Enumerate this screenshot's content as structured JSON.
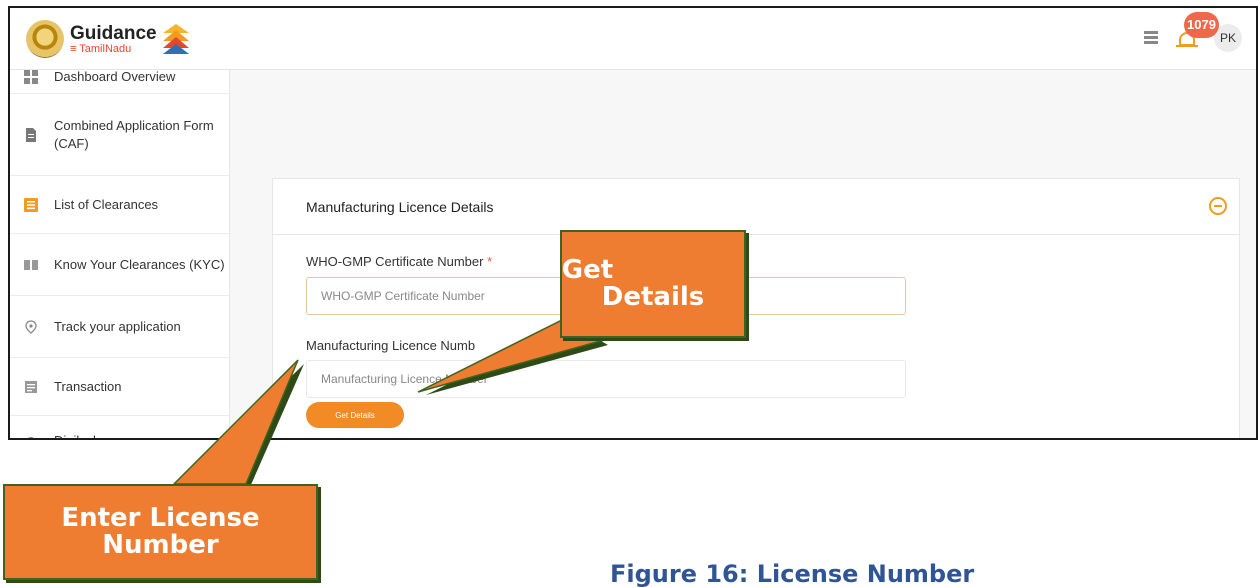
{
  "header": {
    "brand_name": "Guidance",
    "brand_sub": "TamilNadu",
    "notification_count": "1079",
    "avatar_initials": "PK"
  },
  "sidebar": {
    "items": [
      {
        "label": "Dashboard Overview",
        "icon": "dashboard-icon"
      },
      {
        "label": "Combined Application Form (CAF)",
        "icon": "document-icon"
      },
      {
        "label": "List of Clearances",
        "icon": "list-icon",
        "active_color": "#f29b22"
      },
      {
        "label": "Know Your Clearances (KYC)",
        "icon": "book-icon"
      },
      {
        "label": "Track your application",
        "icon": "location-pin-icon"
      },
      {
        "label": "Transaction",
        "icon": "receipt-icon"
      },
      {
        "label": "Digilocker",
        "icon": "cloud-icon"
      }
    ]
  },
  "card": {
    "title": "Manufacturing Licence Details",
    "who_gmp_label": "WHO-GMP Certificate Number",
    "who_gmp_placeholder": "WHO-GMP Certificate Number",
    "required_mark": "*",
    "licence_label": "Manufacturing Licence Numb",
    "licence_placeholder": "Manufacturing Licence Number",
    "get_details_button": "Get Details"
  },
  "callouts": {
    "get_details": {
      "line1": "Get",
      "line2": "Details"
    },
    "enter_license": {
      "line1": "Enter License",
      "line2": "Number"
    }
  },
  "caption": "Figure 16: License Number",
  "colors": {
    "accent_orange": "#f28a25",
    "callout_fill": "#ee7d32",
    "callout_border": "#3f6320",
    "caption_blue": "#2f5597",
    "badge_red": "#f0684b"
  }
}
